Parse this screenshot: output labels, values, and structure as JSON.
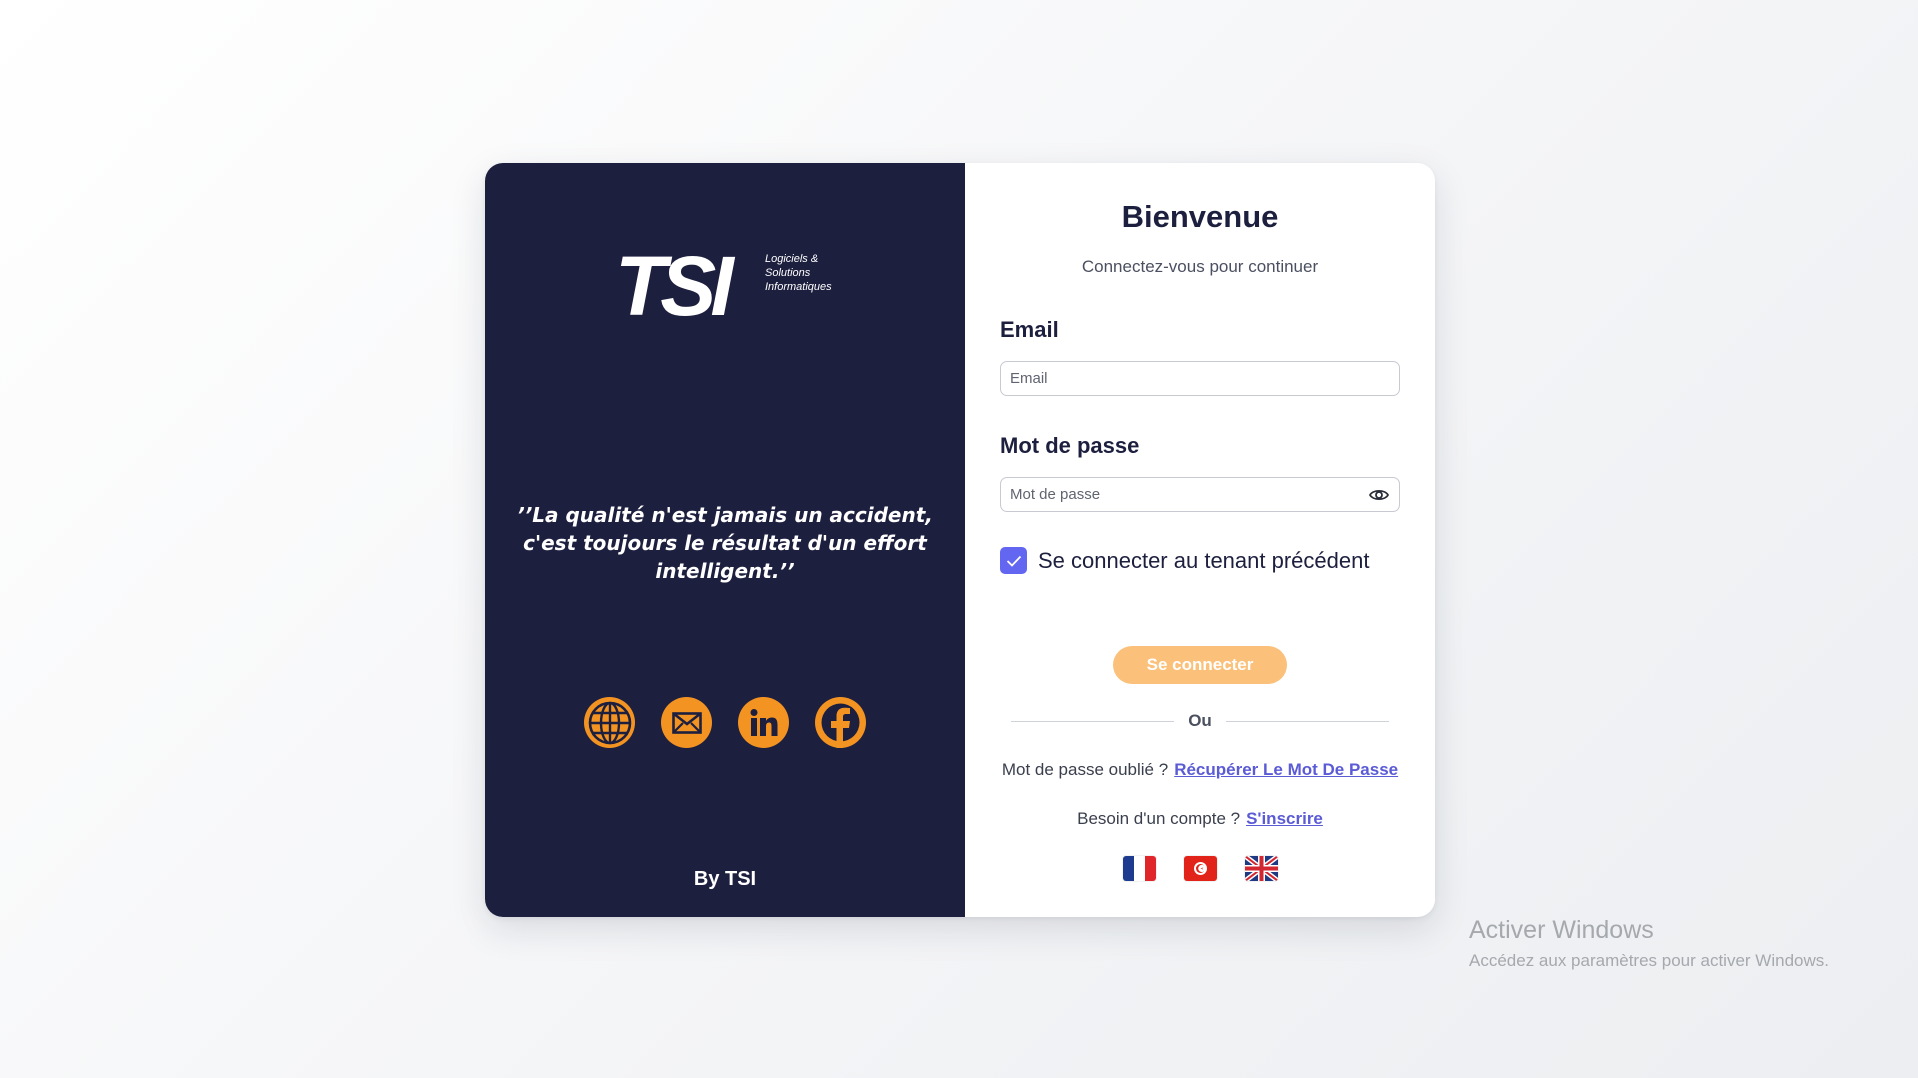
{
  "brand": {
    "logo_text": "TSI",
    "tagline": [
      "Logiciels &",
      "Solutions",
      "Informatiques"
    ],
    "quote": "’’La qualité n'est jamais un accident, c'est toujours le résultat d'un effort intelligent.’’",
    "by": "By TSI",
    "socials": [
      {
        "name": "Website",
        "icon": "globe-icon"
      },
      {
        "name": "Email",
        "icon": "mail-icon"
      },
      {
        "name": "LinkedIn",
        "icon": "linkedin-icon"
      },
      {
        "name": "Facebook",
        "icon": "facebook-icon"
      }
    ],
    "accent_color": "#f39322",
    "panel_color": "#1d1f3f"
  },
  "login": {
    "title": "Bienvenue",
    "subtitle": "Connectez-vous pour continuer",
    "email_label": "Email",
    "email_placeholder": "Email",
    "email_value": "",
    "password_label": "Mot de passe",
    "password_placeholder": "Mot de passe",
    "password_value": "",
    "remember_tenant_label": "Se connecter au tenant précédent",
    "remember_tenant_checked": true,
    "submit_label": "Se connecter",
    "divider_text": "Ou",
    "forgot_text": "Mot de passe oublié ?",
    "forgot_link": "Récupérer Le Mot De Passe",
    "signup_text": "Besoin d'un compte ?",
    "signup_link": "S'inscrire",
    "languages": [
      "fr",
      "tn",
      "en"
    ],
    "checkbox_color": "#6366f1",
    "button_color": "#fbc07a",
    "link_color": "#5b5bd6"
  },
  "watermark": {
    "title": "Activer Windows",
    "subtitle": "Accédez aux paramètres pour activer Windows."
  }
}
